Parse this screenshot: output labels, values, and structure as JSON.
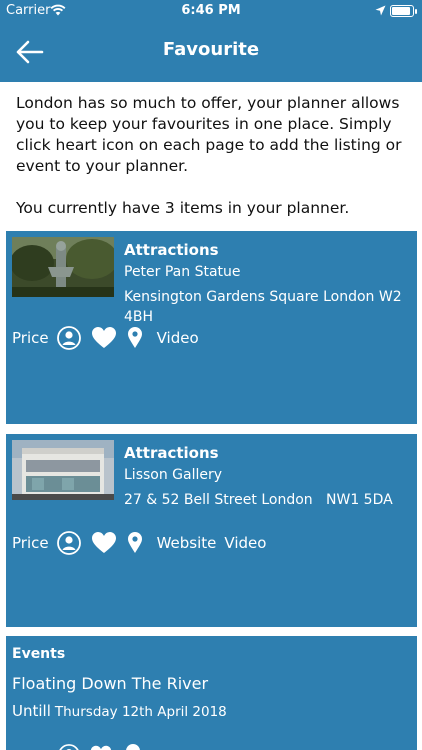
{
  "status_bar": {
    "carrier": "Carrier",
    "time": "6:46 PM"
  },
  "nav": {
    "title": "Favourite",
    "back_icon": "arrow-left-icon"
  },
  "intro": {
    "paragraph1": "London has so much to offer, your planner allows you to keep your favourites in one place. Simply click heart icon on each page to add the listing or event to your planner.",
    "paragraph2": "You currently have 3 items in your planner."
  },
  "items": [
    {
      "category": "Attractions",
      "name": "Peter Pan Statue",
      "address": "Kensington Gardens Square London W2 4BH",
      "price_label": "Price",
      "video_label": "Video"
    },
    {
      "category": "Attractions",
      "name": "Lisson Gallery",
      "address": "27 & 52 Bell Street London   NW1 5DA",
      "price_label": "Price",
      "website_label": "Website",
      "video_label": "Video"
    },
    {
      "category": "Events",
      "name": "Floating Down The River",
      "until_label": "Untill",
      "date": "Thursday 12th April 2018"
    }
  ],
  "colors": {
    "brand_blue": "#2e7fb0",
    "text": "#111111",
    "white": "#ffffff"
  }
}
